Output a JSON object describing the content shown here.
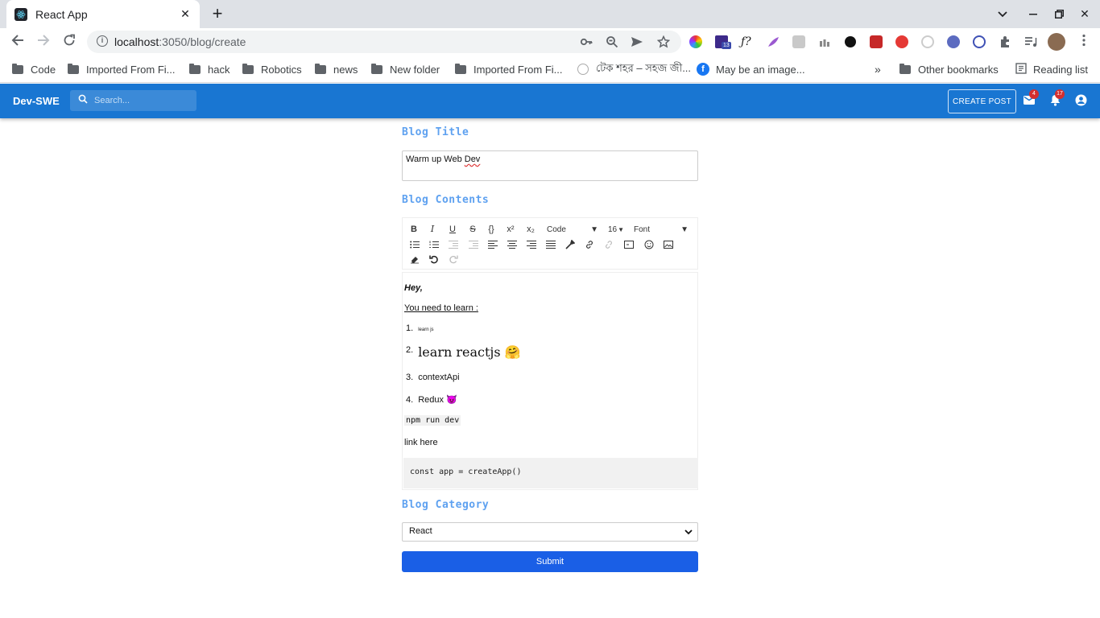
{
  "browser": {
    "tab_title": "React App",
    "url_host": "localhost",
    "url_rest": ":3050/blog/create",
    "bookmarks": [
      "Code",
      "Imported From Fi...",
      "hack",
      "Robotics",
      "news",
      "New folder",
      "Imported From Fi...",
      "টেক শহর – সহজ জী...",
      "May be an image..."
    ],
    "other_bookmarks": "Other bookmarks",
    "reading_list": "Reading list",
    "ext_badge": "13"
  },
  "appbar": {
    "brand": "Dev-SWE",
    "search_placeholder": "Search...",
    "create_post": "CREATE POST",
    "mail_count": "4",
    "notif_count": "17"
  },
  "form": {
    "title_label": "Blog Title",
    "title_value_pre": "Warm up Web ",
    "title_value_word": "Dev",
    "contents_label": "Blog Contents",
    "toolbar": {
      "format_select": "Code",
      "size_select": "16",
      "font_select": "Font",
      "bold": "B",
      "italic": "I",
      "underline": "U",
      "strike": "S",
      "code": "{}",
      "sup": "x²",
      "sub": "x₂"
    },
    "content": {
      "greeting": "Hey,",
      "intro": "You need to learn :",
      "list": [
        {
          "num": "1.",
          "text": "learn js"
        },
        {
          "num": "2.",
          "text": "learn reactjs 🤗"
        },
        {
          "num": "3.",
          "text": "contextApi"
        },
        {
          "num": "4.",
          "text": "Redux 😈"
        }
      ],
      "inline_code": "npm run dev",
      "link": "link here",
      "code_block": "const app = createApp()"
    },
    "category_label": "Blog Category",
    "category_value": "React",
    "submit": "Submit"
  }
}
